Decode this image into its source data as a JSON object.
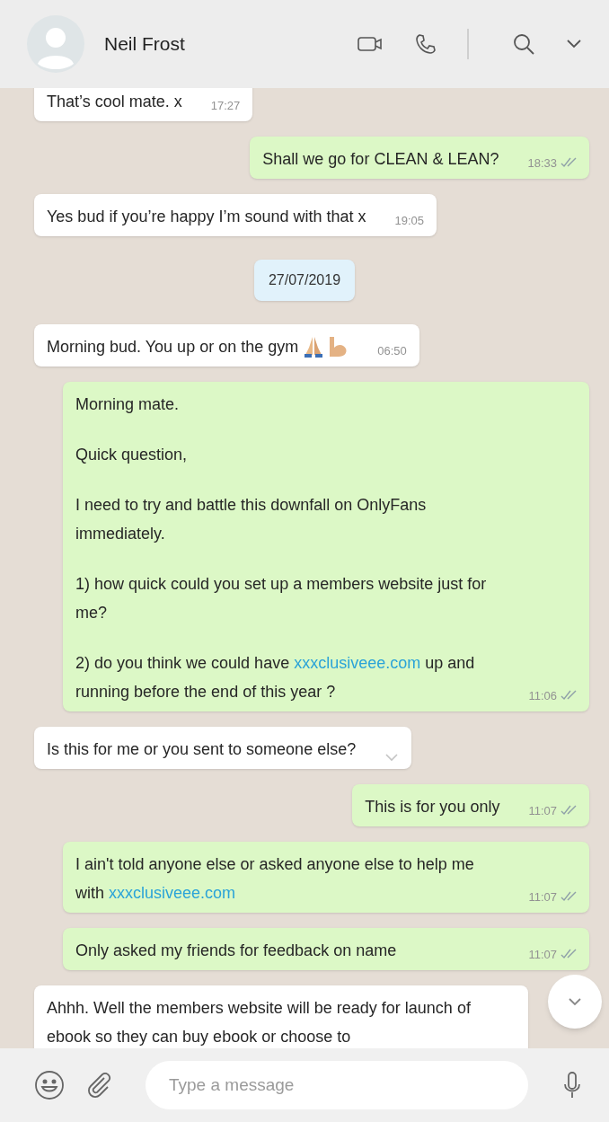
{
  "header": {
    "name": "Neil Frost"
  },
  "messages": [
    {
      "kind": "incoming",
      "paragraphs": [
        [
          {
            "kind": "text",
            "text": "That’s cool mate. x"
          }
        ]
      ],
      "time": "17:27"
    },
    {
      "kind": "outgoing",
      "paragraphs": [
        [
          {
            "kind": "text",
            "text": "Shall we go for CLEAN & LEAN?"
          }
        ]
      ],
      "time": "18:33",
      "delivered": true
    },
    {
      "kind": "incoming",
      "paragraphs": [
        [
          {
            "kind": "text",
            "text": "Yes bud if you’re happy I’m sound with that x"
          }
        ]
      ],
      "time": "19:05"
    },
    {
      "kind": "date",
      "text": "27/07/2019"
    },
    {
      "kind": "incoming",
      "paragraphs": [
        [
          {
            "kind": "text",
            "text": "Morning bud. You up or on the gym"
          }
        ]
      ],
      "emoji": [
        {
          "kind": "folded-hands"
        },
        {
          "kind": "flexed-biceps"
        }
      ],
      "time": "06:50"
    },
    {
      "kind": "outgoing",
      "paragraphs": [
        [
          {
            "kind": "text",
            "text": "Morning mate."
          }
        ],
        [
          {
            "kind": "text",
            "text": "Quick question,"
          }
        ],
        [
          {
            "kind": "text",
            "text": "I need to try and battle this downfall on OnlyFans immediately."
          }
        ],
        [
          {
            "kind": "text",
            "text": "1) how quick could you set up a members website just for me?"
          }
        ],
        [
          {
            "kind": "text",
            "text": "2) do you think we could have "
          },
          {
            "kind": "link",
            "text": "xxxclusiveee.com"
          },
          {
            "kind": "text",
            "text": " up and running before the end of this year ?"
          }
        ]
      ],
      "time": "11:06",
      "delivered": true
    },
    {
      "kind": "incoming",
      "paragraphs": [
        [
          {
            "kind": "text",
            "text": "Is this for me or you sent to someone else?"
          }
        ]
      ],
      "menu_hover": true
    },
    {
      "kind": "outgoing",
      "paragraphs": [
        [
          {
            "kind": "text",
            "text": "This is for you only"
          }
        ]
      ],
      "time": "11:07",
      "delivered": true
    },
    {
      "kind": "outgoing",
      "paragraphs": [
        [
          {
            "kind": "text",
            "text": "I ain't told anyone else or asked anyone else to help me with "
          },
          {
            "kind": "link",
            "text": "xxxclusiveee.com"
          }
        ]
      ],
      "time": "11:07",
      "delivered": true
    },
    {
      "kind": "outgoing",
      "paragraphs": [
        [
          {
            "kind": "text",
            "text": "Only asked my friends for feedback on name"
          }
        ]
      ],
      "time": "11:07",
      "delivered": true,
      "wide": true
    },
    {
      "kind": "incoming",
      "paragraphs": [
        [
          {
            "kind": "text",
            "text": "Ahhh. Well the members website will be ready for launch of ebook so they can buy ebook or choose to"
          }
        ]
      ]
    }
  ],
  "composer": {
    "placeholder": "Type a message"
  }
}
